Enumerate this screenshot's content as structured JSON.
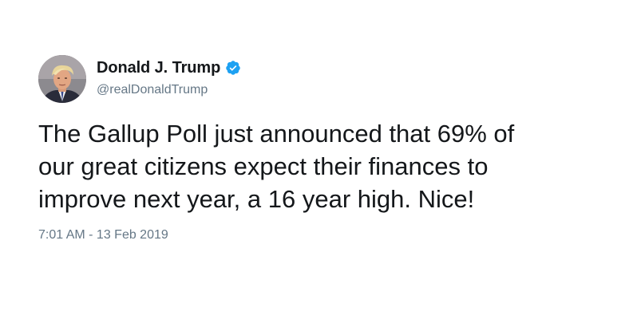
{
  "author": {
    "display_name": "Donald J. Trump",
    "handle": "@realDonaldTrump",
    "verified": true,
    "avatar_icon": "profile-photo"
  },
  "tweet": {
    "lines": [
      "The Gallup Poll just announced that 69% of",
      "our great citizens expect their finances to",
      "improve next year, a 16 year high. Nice!"
    ],
    "timestamp": "7:01 AM - 13 Feb 2019"
  },
  "colors": {
    "text_primary": "#14171a",
    "text_secondary": "#657786",
    "verified_blue": "#1da1f2",
    "background": "#ffffff"
  }
}
